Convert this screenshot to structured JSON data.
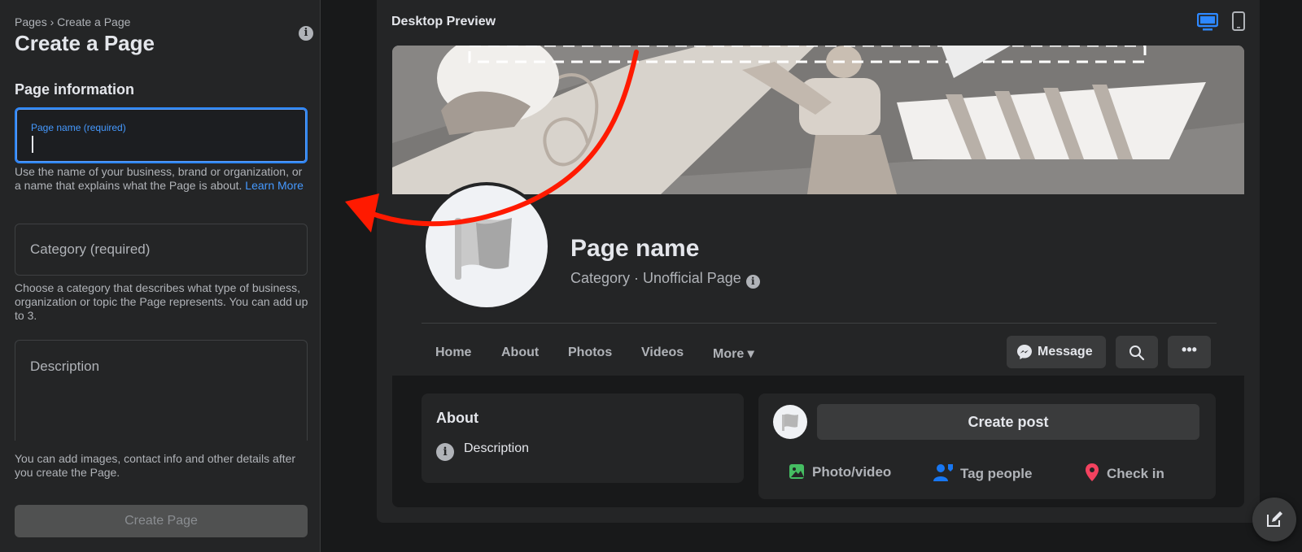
{
  "left_panel": {
    "breadcrumb": "Pages › Create a Page",
    "title": "Create a Page",
    "section_heading": "Page information",
    "page_name_label": "Page name (required)",
    "page_name_value": "",
    "page_name_help": "Use the name of your business, brand or organization, or a name that explains what the Page is about.",
    "learn_more": "Learn More",
    "category_placeholder": "Category (required)",
    "category_help": "Choose a category that describes what type of business, organization or topic the Page represents. You can add up to 3.",
    "description_placeholder": "Description",
    "footer_note": "You can add images, contact info and other details after you create the Page.",
    "create_button": "Create Page"
  },
  "preview": {
    "title": "Desktop Preview",
    "page_name": "Page name",
    "category_line": "Category · Unofficial Page",
    "nav_tabs": [
      "Home",
      "About",
      "Photos",
      "Videos",
      "More ▾"
    ],
    "message_button": "Message",
    "about_heading": "About",
    "about_description": "Description",
    "create_post": "Create post",
    "actions": [
      "Photo/video",
      "Tag people",
      "Check in"
    ]
  },
  "colors": {
    "accent": "#2d88ff",
    "annotation_arrow": "#ff1a00",
    "photo_icon": "#45bd62",
    "tag_icon": "#1877f2",
    "checkin_icon": "#f3425f"
  }
}
